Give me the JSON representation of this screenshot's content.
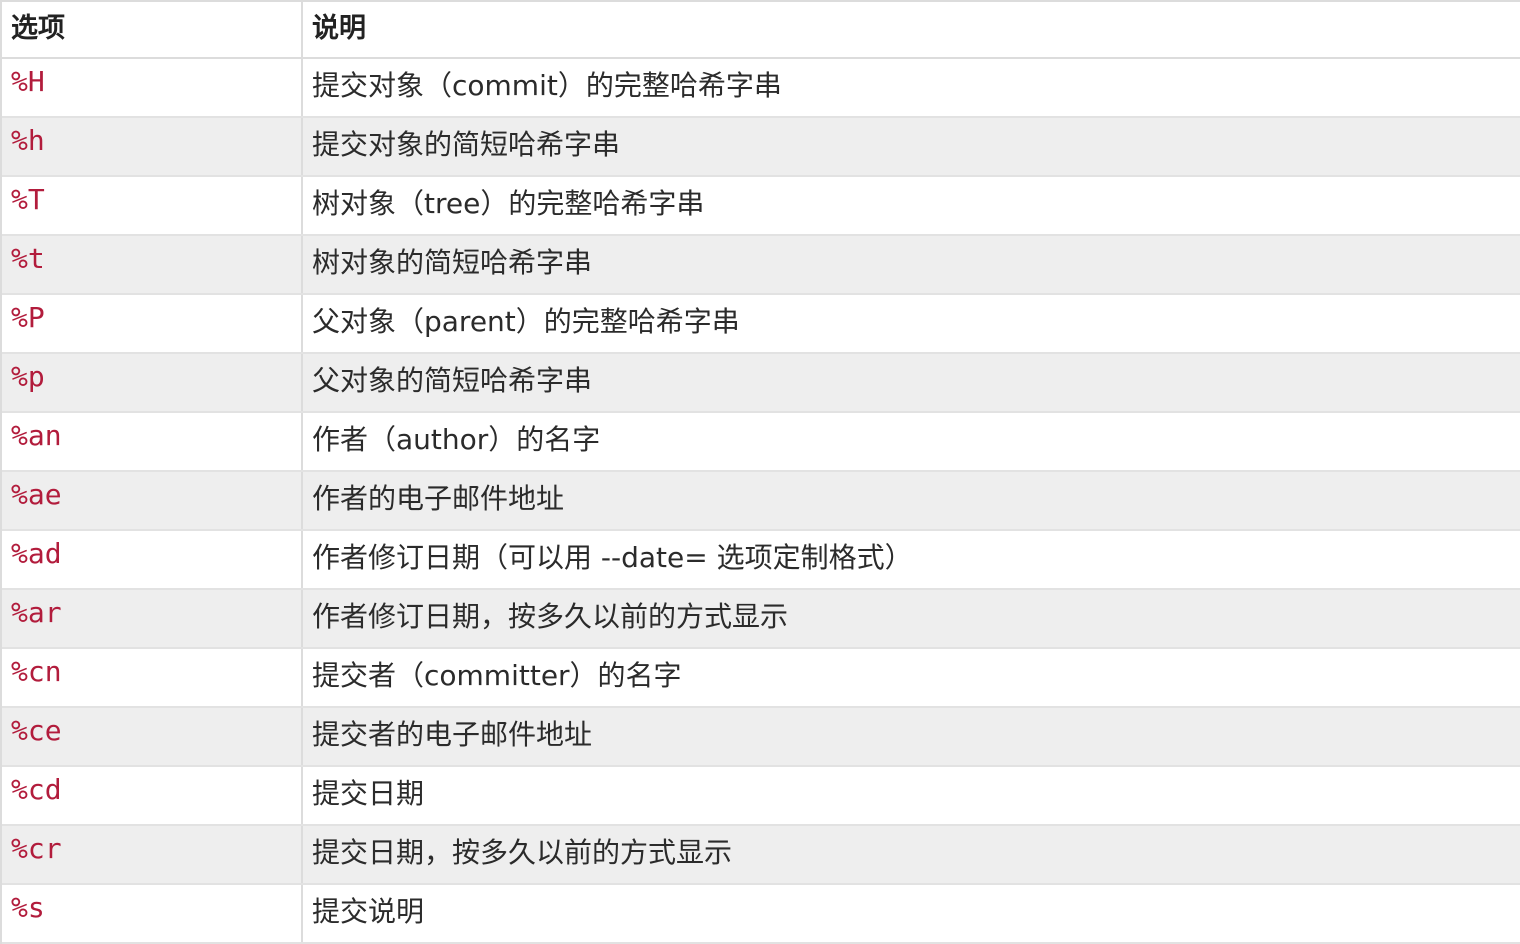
{
  "table": {
    "headers": {
      "option": "选项",
      "description": "说明"
    },
    "rows": [
      {
        "option": "%H",
        "description": "提交对象（commit）的完整哈希字串"
      },
      {
        "option": "%h",
        "description": "提交对象的简短哈希字串"
      },
      {
        "option": "%T",
        "description": "树对象（tree）的完整哈希字串"
      },
      {
        "option": "%t",
        "description": "树对象的简短哈希字串"
      },
      {
        "option": "%P",
        "description": "父对象（parent）的完整哈希字串"
      },
      {
        "option": "%p",
        "description": "父对象的简短哈希字串"
      },
      {
        "option": "%an",
        "description": "作者（author）的名字"
      },
      {
        "option": "%ae",
        "description": "作者的电子邮件地址"
      },
      {
        "option": "%ad",
        "description": "作者修订日期（可以用 --date= 选项定制格式）"
      },
      {
        "option": "%ar",
        "description": "作者修订日期，按多久以前的方式显示"
      },
      {
        "option": "%cn",
        "description": "提交者（committer）的名字"
      },
      {
        "option": "%ce",
        "description": "提交者的电子邮件地址"
      },
      {
        "option": "%cd",
        "description": "提交日期"
      },
      {
        "option": "%cr",
        "description": "提交日期，按多久以前的方式显示"
      },
      {
        "option": "%s",
        "description": "提交说明"
      }
    ]
  },
  "colors": {
    "option_text": "#b21c3c",
    "stripe": "#eeeeee",
    "border": "#dcdcdc"
  }
}
